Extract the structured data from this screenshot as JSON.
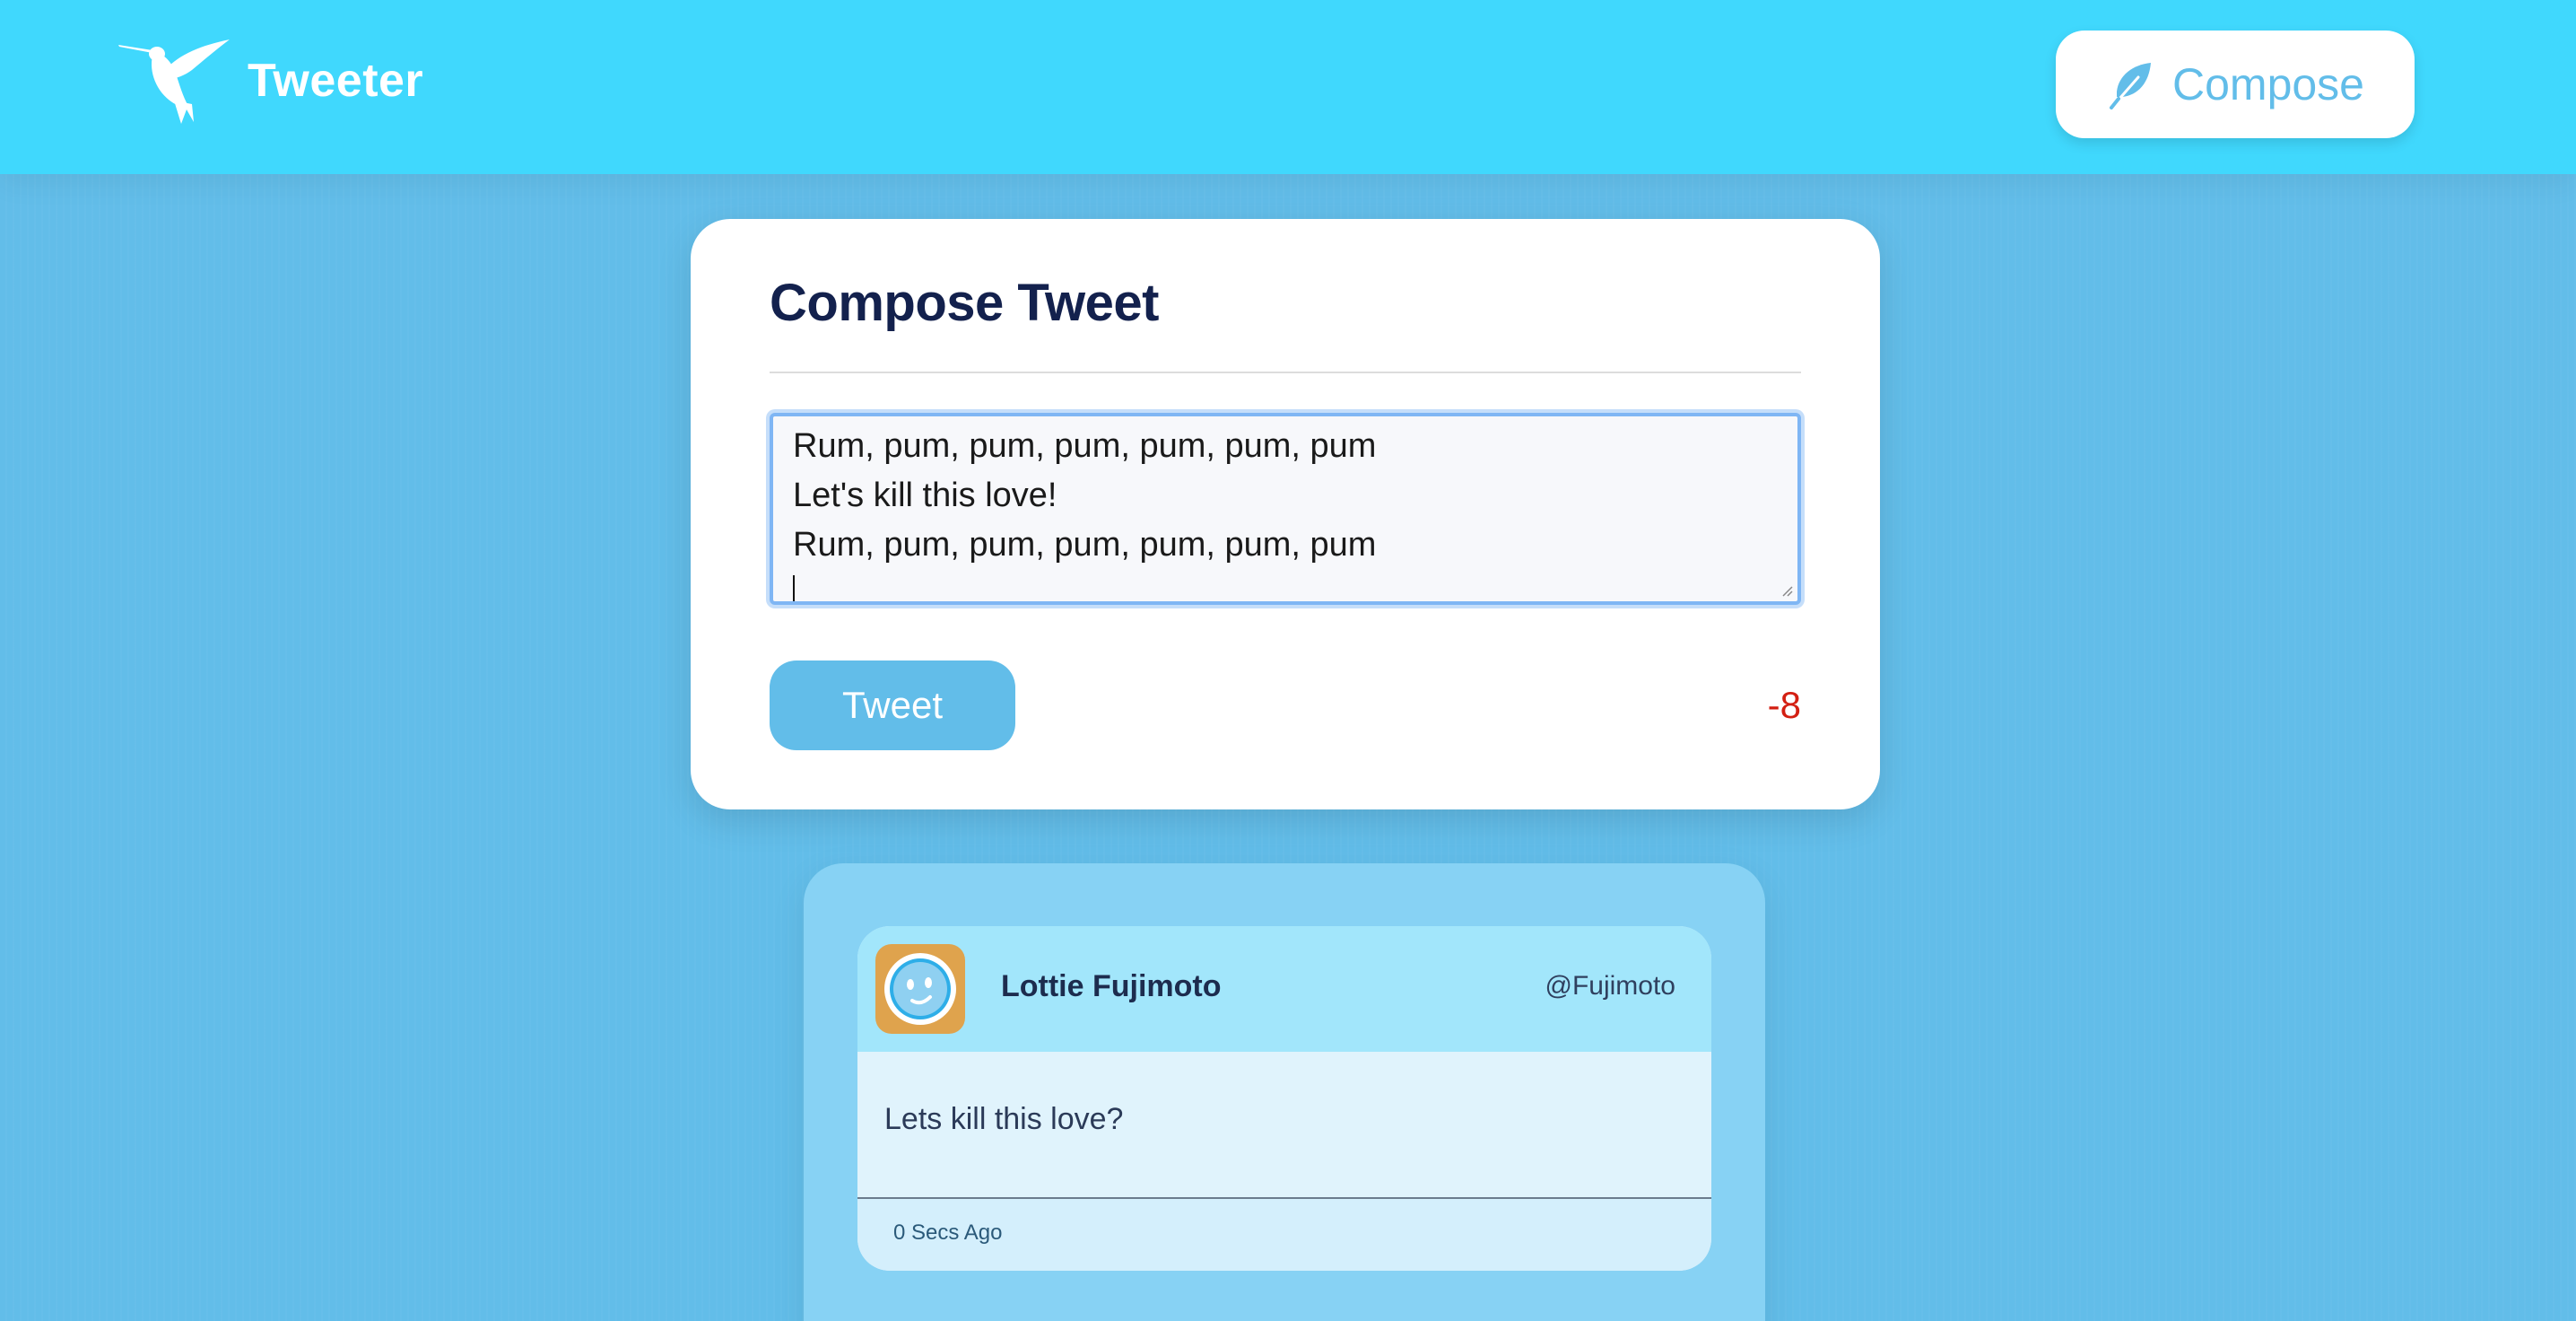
{
  "colors": {
    "page_background": "#62bde9",
    "nav_background": "#40d8fd",
    "accent": "#62bde9",
    "title_text": "#13214d",
    "counter_over_limit": "#d31f12",
    "tweet_header": "#a2e6fb",
    "avatar_background": "#dfa34d"
  },
  "nav": {
    "logo_icon": "hummingbird-icon",
    "brand_name": "Tweeter",
    "compose_button": {
      "icon": "feather-icon",
      "label": "Compose"
    }
  },
  "compose": {
    "title": "Compose Tweet",
    "textarea_lines": [
      "Rum, pum, pum, pum, pum, pum, pum",
      "Let's kill this love!",
      "Rum, pum, pum, pum, pum, pum, pum"
    ],
    "tweet_button": "Tweet",
    "char_counter": "-8"
  },
  "feed": {
    "tweets": [
      {
        "avatar_icon": "smiley-face-avatar-icon",
        "name": "Lottie Fujimoto",
        "handle": "@Fujimoto",
        "content": "Lets kill this love?",
        "timestamp": "0 Secs Ago"
      }
    ]
  }
}
